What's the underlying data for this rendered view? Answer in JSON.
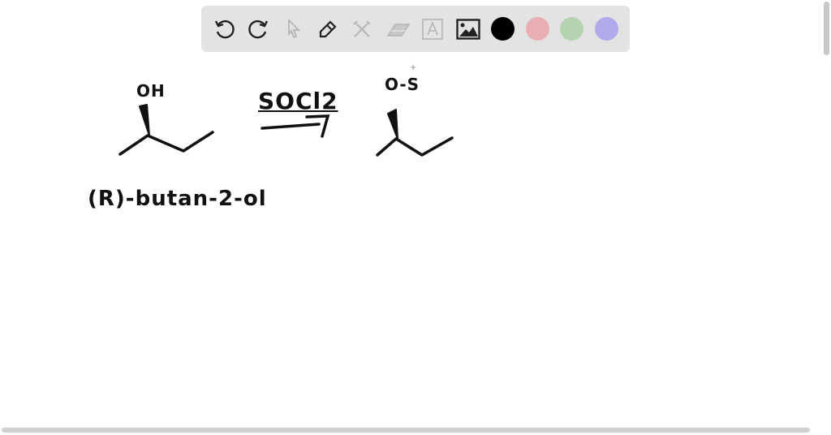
{
  "toolbar": {
    "tools": [
      {
        "name": "undo-icon"
      },
      {
        "name": "redo-icon"
      },
      {
        "name": "select-icon"
      },
      {
        "name": "pen-icon"
      },
      {
        "name": "tools-icon"
      },
      {
        "name": "eraser-icon"
      },
      {
        "name": "text-icon"
      },
      {
        "name": "image-icon"
      }
    ],
    "colors": [
      "#000000",
      "#e8aeb3",
      "#b5d3b0",
      "#b1aaea"
    ]
  },
  "canvas": {
    "reactant_group": "OH",
    "reagent": "SOCl2",
    "product_group": "O-S",
    "reactant_name": "(R)-butan-2-ol"
  }
}
